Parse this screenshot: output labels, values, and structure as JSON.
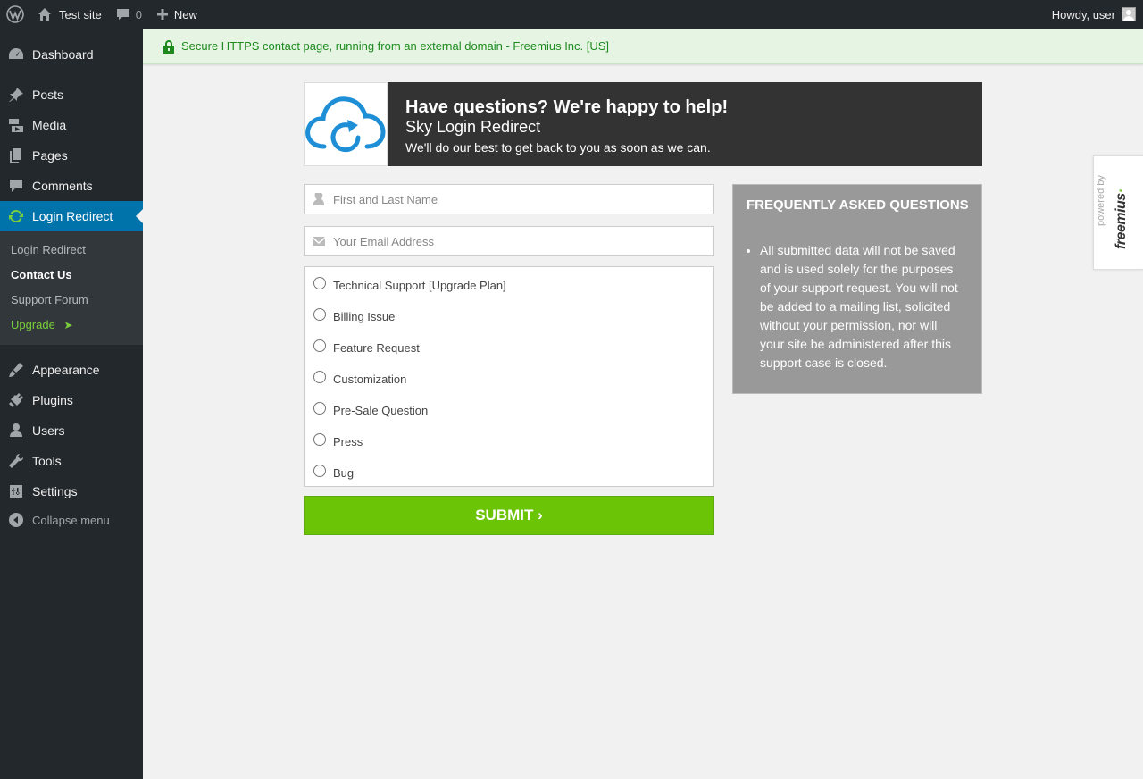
{
  "adminbar": {
    "site_name": "Test site",
    "comments_count": "0",
    "new_label": "New",
    "greeting": "Howdy, user"
  },
  "sidebar": {
    "items": [
      {
        "label": "Dashboard",
        "icon": "dashboard-icon"
      },
      {
        "label": "Posts",
        "icon": "pin-icon"
      },
      {
        "label": "Media",
        "icon": "media-icon"
      },
      {
        "label": "Pages",
        "icon": "pages-icon"
      },
      {
        "label": "Comments",
        "icon": "comment-icon"
      },
      {
        "label": "Login Redirect",
        "icon": "refresh-icon",
        "current": true
      },
      {
        "label": "Appearance",
        "icon": "brush-icon"
      },
      {
        "label": "Plugins",
        "icon": "plug-icon"
      },
      {
        "label": "Users",
        "icon": "user-icon"
      },
      {
        "label": "Tools",
        "icon": "wrench-icon"
      },
      {
        "label": "Settings",
        "icon": "settings-icon"
      }
    ],
    "submenu": [
      "Login Redirect",
      "Contact Us",
      "Support Forum",
      "Upgrade"
    ],
    "upgrade_arrow": "➤",
    "collapse_label": "Collapse menu"
  },
  "notice": {
    "text": "Secure HTTPS contact page, running from an external domain - Freemius Inc. [US]"
  },
  "header": {
    "title": "Have questions? We're happy to help!",
    "plugin_name": "Sky Login Redirect",
    "subtitle": "We'll do our best to get back to you as soon as we can."
  },
  "form": {
    "name_placeholder": "First and Last Name",
    "email_placeholder": "Your Email Address",
    "types": [
      "Technical Support [Upgrade Plan]",
      "Billing Issue",
      "Feature Request",
      "Customization",
      "Pre-Sale Question",
      "Press",
      "Bug"
    ],
    "submit_label": "SUBMIT ›"
  },
  "faq": {
    "title": "FREQUENTLY ASKED QUESTIONS",
    "items": [
      "All submitted data will not be saved and is used solely for the purposes of your support request. You will not be added to a mailing list, solicited without your permission, nor will your site be administered after this support case is closed."
    ]
  },
  "badge": {
    "powered_by": "powered by",
    "brand": "freemius"
  },
  "colors": {
    "accent": "#0073aa",
    "submit": "#6bc406",
    "notice_text": "#1e8a1e"
  }
}
